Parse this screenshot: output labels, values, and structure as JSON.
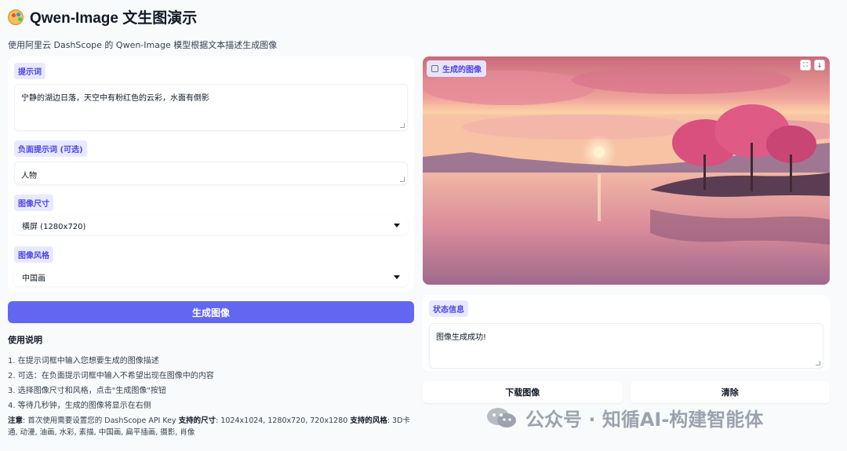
{
  "header": {
    "title": "Qwen-Image 文生图演示",
    "subtitle": "使用阿里云 DashScope 的 Qwen-Image 模型根据文本描述生成图像"
  },
  "form": {
    "prompt": {
      "label": "提示词",
      "value": "宁静的湖边日落，天空中有粉红色的云彩，水面有倒影"
    },
    "negative_prompt": {
      "label": "负面提示词 (可选)",
      "value": "人物"
    },
    "size": {
      "label": "图像尺寸",
      "value": "横屏 (1280x720)"
    },
    "style": {
      "label": "图像风格",
      "value": "中国画"
    },
    "generate_label": "生成图像"
  },
  "instructions": {
    "heading": "使用说明",
    "steps": [
      "1. 在提示词框中输入您想要生成的图像描述",
      "2. 可选：在负面提示词框中输入不希望出现在图像中的内容",
      "3. 选择图像尺寸和风格，点击\"生成图像\"按钮",
      "4. 等待几秒钟，生成的图像将显示在右侧"
    ],
    "note_label": "注意",
    "note_text": ": 首次使用需要设置您的 DashScope API Key ",
    "sizes_label": "支持的尺寸",
    "sizes_text": ": 1024x1024, 1280x720, 720x1280 ",
    "styles_label": "支持的风格",
    "styles_text": ": 3D卡通, 动漫, 油画, 水彩, 素描, 中国画, 扁平插画, 摄影, 肖像"
  },
  "output": {
    "image_label": "生成的图像",
    "status_label": "状态信息",
    "status_value": "图像生成成功!",
    "download_label": "下载图像",
    "clear_label": "清除"
  },
  "watermark": {
    "text": "公众号 · 知循AI-构建智能体"
  },
  "icons": {
    "title": "palette-icon",
    "image_chip": "image-icon",
    "fullscreen": "fullscreen-icon",
    "download": "download-icon"
  },
  "colors": {
    "accent": "#6366f1",
    "chip_bg": "#e8e9ff",
    "chip_text": "#4f46e5"
  }
}
